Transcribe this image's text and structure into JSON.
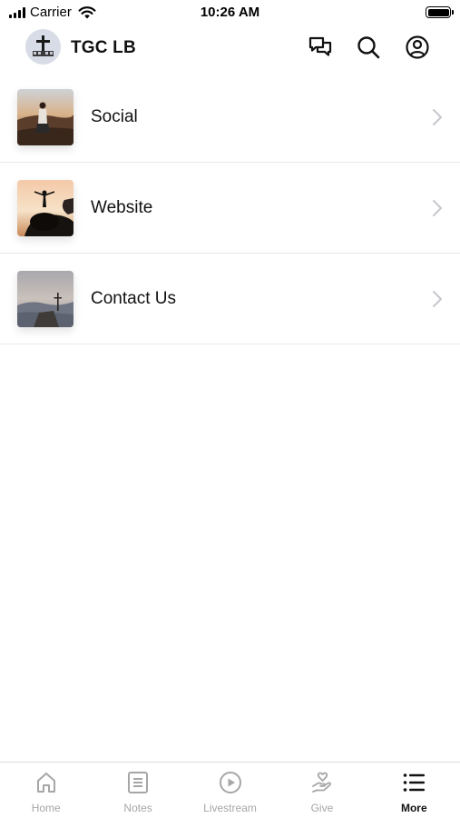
{
  "status_bar": {
    "carrier": "Carrier",
    "time": "10:26 AM"
  },
  "header": {
    "title": "TGC LB"
  },
  "list": {
    "items": [
      {
        "label": "Social"
      },
      {
        "label": "Website"
      },
      {
        "label": "Contact Us"
      }
    ]
  },
  "tabbar": {
    "tabs": [
      {
        "label": "Home",
        "icon": "home-icon"
      },
      {
        "label": "Notes",
        "icon": "notes-icon"
      },
      {
        "label": "Livestream",
        "icon": "play-circle-icon"
      },
      {
        "label": "Give",
        "icon": "give-hand-heart-icon"
      },
      {
        "label": "More",
        "icon": "list-icon"
      }
    ],
    "active": "More"
  },
  "colors": {
    "inactive": "#a6a6a6",
    "active": "#111111",
    "divider": "#e8e8e8"
  }
}
